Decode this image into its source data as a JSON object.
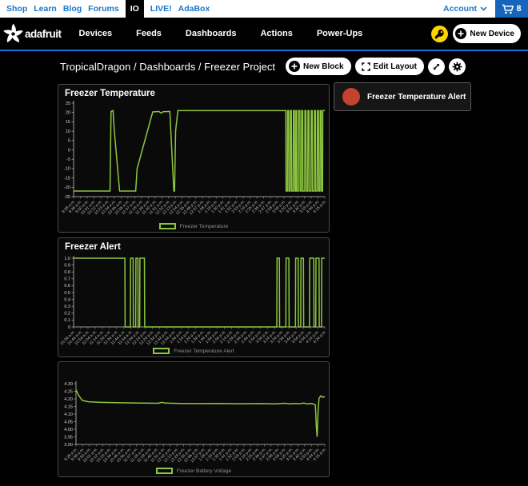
{
  "top_bar": {
    "links": [
      "Shop",
      "Learn",
      "Blog",
      "Forums"
    ],
    "io_tab": "IO",
    "links_right": [
      "LIVE!",
      "AdaBox"
    ],
    "account_label": "Account",
    "cart_count": "8"
  },
  "main_nav": {
    "brand": "adafruit",
    "items": [
      "Devices",
      "Feeds",
      "Dashboards",
      "Actions",
      "Power-Ups"
    ],
    "new_device_label": "New Device"
  },
  "breadcrumb": {
    "text": "TropicalDragon / Dashboards / Freezer Project"
  },
  "toolbar": {
    "new_block_label": "New Block",
    "edit_layout_label": "Edit Layout"
  },
  "alert_block": {
    "label": "Freezer Temperature Alert",
    "indicator_color": "#c2432e"
  },
  "colors": {
    "line_green": "#8dc63f",
    "link_blue": "#1b77c9",
    "divider_blue": "#1e6fe0",
    "key_yellow": "#ffd500"
  },
  "chart_data": [
    {
      "type": "line",
      "title": "Freezer Temperature",
      "legend": "Freezer Temperature",
      "color": "#8dc63f",
      "ylim": [
        -25,
        25
      ],
      "y_ticks": [
        [
          25,
          "25"
        ],
        [
          20,
          "20"
        ],
        [
          15,
          "15"
        ],
        [
          10,
          "10"
        ],
        [
          5,
          "5"
        ],
        [
          0,
          "0"
        ],
        [
          -5,
          "-5"
        ],
        [
          -10,
          "-10"
        ],
        [
          -15,
          "-15"
        ],
        [
          -20,
          "-20"
        ],
        [
          -25,
          "-25"
        ]
      ],
      "x_labels": [
        "9:28 a.m.",
        "9:39 a.m.",
        "9:50 a.m.",
        "10:01 a.m.",
        "10:12 a.m.",
        "10:23 a.m.",
        "10:34 a.m.",
        "10:45 a.m.",
        "10:56 a.m.",
        "11:07 a.m.",
        "11:18 a.m.",
        "11:29 a.m.",
        "11:40 a.m.",
        "11:51 a.m.",
        "12:02 p.m.",
        "12:13 p.m.",
        "12:24 p.m.",
        "12:35 p.m.",
        "12:46 p.m.",
        "12:57 p.m.",
        "1:08 p.m.",
        "1:19 p.m.",
        "1:30 p.m.",
        "1:41 p.m.",
        "1:52 p.m.",
        "2:03 p.m.",
        "2:14 p.m.",
        "2:25 p.m.",
        "2:36 p.m.",
        "2:47 p.m.",
        "2:58 p.m.",
        "3:09 p.m.",
        "3:20 p.m.",
        "3:31 p.m.",
        "3:42 p.m.",
        "3:53 p.m.",
        "4:04 p.m.",
        "4:15 p.m."
      ],
      "points": [
        [
          0,
          -22
        ],
        [
          0.145,
          -22
        ],
        [
          0.149,
          20.5
        ],
        [
          0.157,
          21
        ],
        [
          0.162,
          10
        ],
        [
          0.183,
          -22
        ],
        [
          0.247,
          -22
        ],
        [
          0.253,
          -10
        ],
        [
          0.315,
          20.3
        ],
        [
          0.34,
          20.5
        ],
        [
          0.348,
          19.6
        ],
        [
          0.356,
          20.4
        ],
        [
          0.378,
          20.5
        ],
        [
          0.383,
          20.5
        ],
        [
          0.399,
          -22
        ],
        [
          0.402,
          -22
        ],
        [
          0.406,
          10
        ],
        [
          0.415,
          21
        ],
        [
          0.843,
          21
        ],
        [
          0.845,
          21
        ],
        [
          0.846,
          -22
        ],
        [
          0.851,
          -22
        ],
        [
          0.852,
          21
        ],
        [
          0.856,
          21
        ],
        [
          0.857,
          -22
        ],
        [
          0.862,
          -22
        ],
        [
          0.863,
          21
        ],
        [
          0.867,
          21
        ],
        [
          0.868,
          -22
        ],
        [
          0.874,
          -22
        ],
        [
          0.875,
          21
        ],
        [
          0.879,
          21
        ],
        [
          0.88,
          -22
        ],
        [
          0.884,
          -22
        ],
        [
          0.885,
          21
        ],
        [
          0.888,
          21
        ],
        [
          0.889,
          -22
        ],
        [
          0.895,
          -22
        ],
        [
          0.896,
          21
        ],
        [
          0.901,
          21
        ],
        [
          0.902,
          -22
        ],
        [
          0.907,
          -22
        ],
        [
          0.908,
          21
        ],
        [
          0.912,
          21
        ],
        [
          0.913,
          -22
        ],
        [
          0.92,
          -22
        ],
        [
          0.921,
          21
        ],
        [
          0.925,
          21
        ],
        [
          0.926,
          -22
        ],
        [
          0.932,
          -22
        ],
        [
          0.933,
          21
        ],
        [
          0.937,
          21
        ],
        [
          0.938,
          -22
        ],
        [
          0.945,
          -22
        ],
        [
          0.946,
          21
        ],
        [
          0.95,
          21
        ],
        [
          0.951,
          -22
        ],
        [
          0.958,
          -22
        ],
        [
          0.959,
          21
        ],
        [
          0.963,
          21
        ],
        [
          0.964,
          -22
        ],
        [
          0.97,
          -22
        ],
        [
          0.971,
          21
        ],
        [
          0.975,
          21
        ],
        [
          0.976,
          -22
        ],
        [
          0.981,
          -22
        ],
        [
          0.982,
          21
        ],
        [
          0.986,
          21
        ],
        [
          0.987,
          -22
        ],
        [
          0.991,
          -22
        ],
        [
          0.992,
          21
        ],
        [
          1,
          21
        ]
      ]
    },
    {
      "type": "line",
      "title": "Freezer Alert",
      "legend": "Freezer Temperature Alert",
      "color": "#8dc63f",
      "ylim": [
        0,
        1
      ],
      "y_ticks": [
        [
          1,
          "1.0"
        ],
        [
          0.9,
          "0.9"
        ],
        [
          0.8,
          "0.8"
        ],
        [
          0.7,
          "0.7"
        ],
        [
          0.6,
          "0.6"
        ],
        [
          0.5,
          "0.5"
        ],
        [
          0.4,
          "0.4"
        ],
        [
          0.3,
          "0.3"
        ],
        [
          0.2,
          "0.2"
        ],
        [
          0.1,
          "0.1"
        ],
        [
          0,
          "0"
        ]
      ],
      "x_labels": [
        "10:34 a.m.",
        "10:44 a.m.",
        "10:54 a.m.",
        "11:04 a.m.",
        "11:14 a.m.",
        "11:24 a.m.",
        "11:34 a.m.",
        "11:44 a.m.",
        "11:54 a.m.",
        "12:04 p.m.",
        "12:14 p.m.",
        "12:24 p.m.",
        "12:34 p.m.",
        "12:44 p.m.",
        "12:54 p.m.",
        "1:04 p.m.",
        "1:14 p.m.",
        "1:24 p.m.",
        "1:34 p.m.",
        "1:44 p.m.",
        "1:54 p.m.",
        "2:04 p.m.",
        "2:14 p.m.",
        "2:24 p.m.",
        "2:34 p.m.",
        "2:44 p.m.",
        "2:54 p.m.",
        "3:04 p.m.",
        "3:14 p.m.",
        "3:24 p.m.",
        "3:34 p.m.",
        "3:44 p.m.",
        "3:54 p.m.",
        "4:04 p.m.",
        "4:14 p.m.",
        "4:24 p.m."
      ],
      "points": [
        [
          0,
          1
        ],
        [
          0.204,
          1
        ],
        [
          0.205,
          0
        ],
        [
          0.226,
          0
        ],
        [
          0.227,
          1
        ],
        [
          0.237,
          1
        ],
        [
          0.238,
          0
        ],
        [
          0.247,
          0
        ],
        [
          0.248,
          1
        ],
        [
          0.256,
          1
        ],
        [
          0.257,
          0
        ],
        [
          0.263,
          0
        ],
        [
          0.264,
          1
        ],
        [
          0.282,
          1
        ],
        [
          0.283,
          0
        ],
        [
          0.809,
          0
        ],
        [
          0.81,
          1
        ],
        [
          0.819,
          1
        ],
        [
          0.82,
          0
        ],
        [
          0.845,
          0
        ],
        [
          0.846,
          1
        ],
        [
          0.857,
          1
        ],
        [
          0.858,
          0
        ],
        [
          0.883,
          0
        ],
        [
          0.884,
          1
        ],
        [
          0.894,
          1
        ],
        [
          0.895,
          0
        ],
        [
          0.904,
          0
        ],
        [
          0.905,
          1
        ],
        [
          0.915,
          1
        ],
        [
          0.916,
          0
        ],
        [
          0.939,
          0
        ],
        [
          0.94,
          1
        ],
        [
          0.956,
          1
        ],
        [
          0.957,
          0
        ],
        [
          0.964,
          0
        ],
        [
          0.965,
          1
        ],
        [
          0.977,
          1
        ],
        [
          0.978,
          0
        ],
        [
          0.987,
          0
        ],
        [
          0.988,
          1
        ],
        [
          1,
          1
        ]
      ]
    },
    {
      "type": "line",
      "title": "",
      "legend": "Freezer Battery Voltage",
      "color": "#8dc63f",
      "ylim": [
        3.9,
        4.3
      ],
      "y_ticks": [
        [
          4.3,
          "4.30"
        ],
        [
          4.25,
          "4.25"
        ],
        [
          4.2,
          "4.20"
        ],
        [
          4.15,
          "4.15"
        ],
        [
          4.1,
          "4.10"
        ],
        [
          4.05,
          "4.05"
        ],
        [
          4.0,
          "4.00"
        ],
        [
          3.95,
          "3.95"
        ],
        [
          3.9,
          "3.90"
        ]
      ],
      "x_labels": [
        "9:28 a.m.",
        "9:39 a.m.",
        "9:50 a.m.",
        "10:01 a.m.",
        "10:12 a.m.",
        "10:23 a.m.",
        "10:34 a.m.",
        "10:45 a.m.",
        "10:56 a.m.",
        "11:07 a.m.",
        "11:18 a.m.",
        "11:29 a.m.",
        "11:40 a.m.",
        "11:51 a.m.",
        "12:02 p.m.",
        "12:13 p.m.",
        "12:24 p.m.",
        "12:35 p.m.",
        "12:46 p.m.",
        "12:57 p.m.",
        "1:08 p.m.",
        "1:19 p.m.",
        "1:30 p.m.",
        "1:41 p.m.",
        "1:52 p.m.",
        "2:03 p.m.",
        "2:14 p.m.",
        "2:25 p.m.",
        "2:36 p.m.",
        "2:47 p.m.",
        "2:58 p.m.",
        "3:09 p.m.",
        "3:20 p.m.",
        "3:31 p.m.",
        "3:42 p.m.",
        "3:53 p.m.",
        "4:04 p.m.",
        "4:15 p.m."
      ],
      "points": [
        [
          0,
          4.26
        ],
        [
          0.01,
          4.225
        ],
        [
          0.025,
          4.19
        ],
        [
          0.05,
          4.181
        ],
        [
          0.1,
          4.177
        ],
        [
          0.18,
          4.174
        ],
        [
          0.26,
          4.172
        ],
        [
          0.33,
          4.171
        ],
        [
          0.345,
          4.177
        ],
        [
          0.36,
          4.172
        ],
        [
          0.42,
          4.17
        ],
        [
          0.5,
          4.169
        ],
        [
          0.58,
          4.17
        ],
        [
          0.66,
          4.168
        ],
        [
          0.74,
          4.169
        ],
        [
          0.8,
          4.167
        ],
        [
          0.84,
          4.171
        ],
        [
          0.86,
          4.167
        ],
        [
          0.88,
          4.17
        ],
        [
          0.9,
          4.168
        ],
        [
          0.915,
          4.172
        ],
        [
          0.93,
          4.167
        ],
        [
          0.945,
          4.17
        ],
        [
          0.955,
          4.165
        ],
        [
          0.962,
          4.16
        ],
        [
          0.966,
          4.02
        ],
        [
          0.969,
          3.95
        ],
        [
          0.973,
          4.12
        ],
        [
          0.977,
          4.205
        ],
        [
          0.985,
          4.22
        ],
        [
          0.992,
          4.21
        ],
        [
          1,
          4.215
        ]
      ]
    }
  ]
}
